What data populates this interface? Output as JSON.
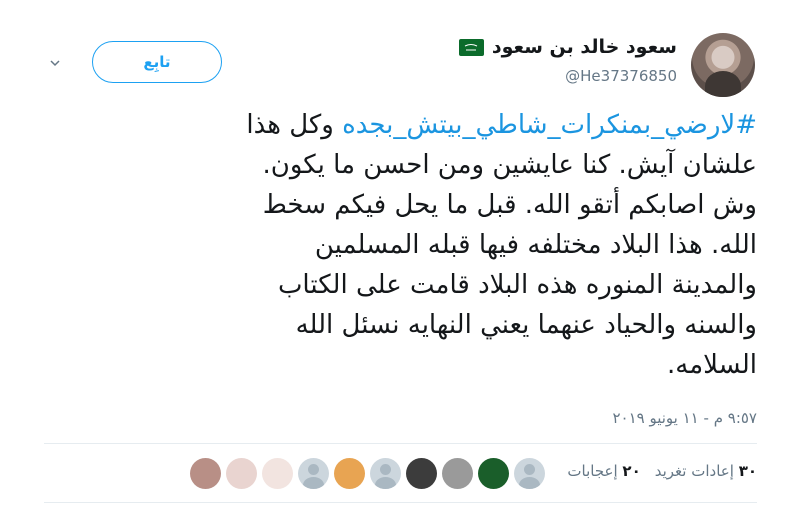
{
  "user": {
    "display_name": "سعود خالد بن سعود",
    "handle": "@He37376850",
    "flag_text": "لا إله"
  },
  "follow_label": "تابِع",
  "tweet": {
    "hashtag": "#لارضي_بمنكرات_شاطي_بيتش_بجده",
    "lines": [
      " وكل هذا",
      "علشان آيش. كنا عايشين ومن احسن ما يكون.",
      "وش اصابكم  أتقو الله. قبل ما يحل فيكم سخط",
      "الله. هذا البلاد مختلفه فيها قبله المسلمين",
      "والمدينة المنوره هذه البلاد قامت على الكتاب",
      "والسنه والحياد عنهما يعني النهايه نسئل الله",
      "السلامه."
    ]
  },
  "timestamp": "٩:٥٧ م - ١١ يونيو ٢٠١٩",
  "stats": {
    "retweets_count": "٣٠",
    "retweets_label": "إعادات تغريد",
    "likes_count": "٢٠",
    "likes_label": "إعجابات"
  },
  "likers": [
    {
      "color": "#b88f86"
    },
    {
      "color": "#e9d4d0"
    },
    {
      "color": "#f2e4e0"
    },
    {
      "color": "#ccd6dd",
      "default": true
    },
    {
      "color": "#e8a452"
    },
    {
      "color": "#ccd6dd",
      "default": true
    },
    {
      "color": "#3c3c3c"
    },
    {
      "color": "#9a9a9a"
    },
    {
      "color": "#1a5e2a"
    },
    {
      "color": "#ccd6dd",
      "default": true
    }
  ],
  "colors": {
    "accent": "#1da1f2",
    "hashtag": "#1b95e0",
    "secondary_text": "#657786"
  }
}
